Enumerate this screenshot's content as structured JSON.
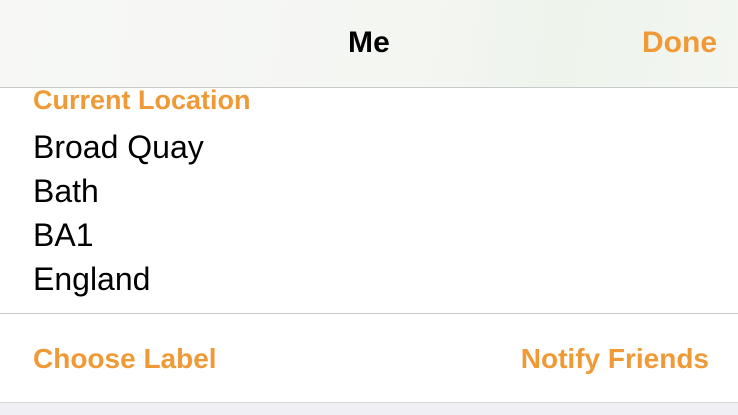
{
  "nav": {
    "title": "Me",
    "done_label": "Done"
  },
  "location": {
    "header": "Current Location",
    "lines": [
      "Broad Quay",
      "Bath",
      "BA1",
      "England"
    ]
  },
  "actions": {
    "choose_label": "Choose Label",
    "notify_friends": "Notify Friends"
  },
  "colors": {
    "accent": "#f09a37",
    "text": "#000000",
    "separator": "#c9c9cc",
    "background_group": "#efeff4"
  }
}
